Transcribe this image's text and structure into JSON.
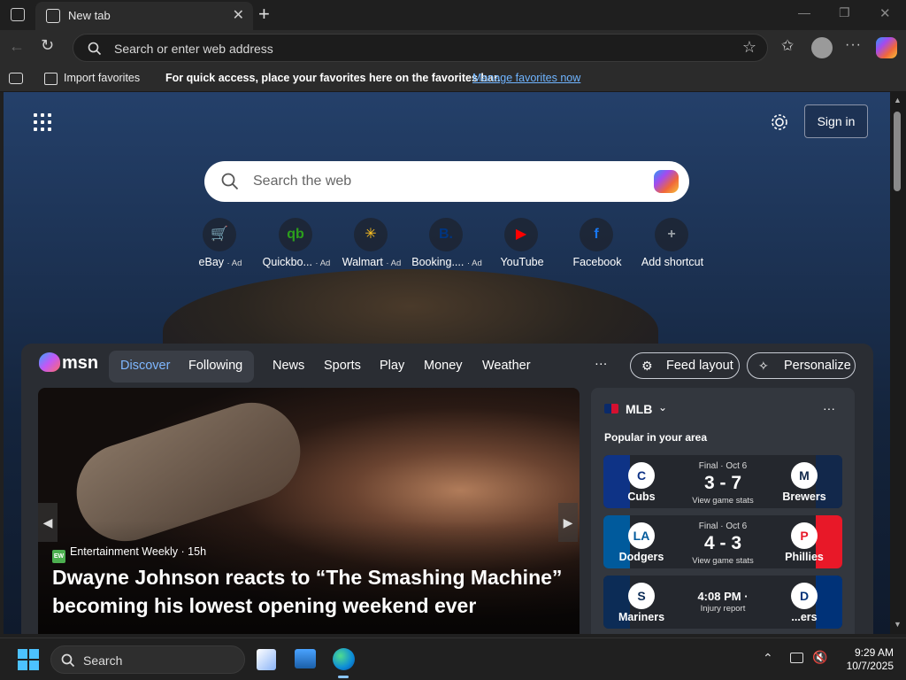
{
  "window": {
    "tab_title": "New tab",
    "tab_close": "✕",
    "new_tab": "+",
    "minimize": "—",
    "restore": "❐",
    "close": "✕"
  },
  "toolbar": {
    "address_placeholder": "Search or enter web address"
  },
  "favorites_bar": {
    "import_label": "Import favorites",
    "hint": "For quick access, place your favorites here on the favorites bar.",
    "manage_link": "Manage favorites now"
  },
  "newtab": {
    "sign_in": "Sign in",
    "search_placeholder": "Search the web",
    "shortcuts": [
      {
        "label": "eBay",
        "ad": "· Ad",
        "glyph": "🛒",
        "color": "#e53238"
      },
      {
        "label": "Quickbo...",
        "ad": "· Ad",
        "glyph": "qb",
        "color": "#2ca01c"
      },
      {
        "label": "Walmart",
        "ad": "· Ad",
        "glyph": "✳",
        "color": "#ffc220"
      },
      {
        "label": "Booking....",
        "ad": "· Ad",
        "glyph": "B.",
        "color": "#003580"
      },
      {
        "label": "YouTube",
        "ad": "",
        "glyph": "▶",
        "color": "#ff0000"
      },
      {
        "label": "Facebook",
        "ad": "",
        "glyph": "f",
        "color": "#1877f2"
      },
      {
        "label": "Add shortcut",
        "ad": "",
        "glyph": "+",
        "color": "#9aa0a6"
      }
    ]
  },
  "feed": {
    "logo": "msn",
    "tabs": [
      "Discover",
      "Following"
    ],
    "nav": [
      "News",
      "Sports",
      "Play",
      "Money",
      "Weather"
    ],
    "more": "···",
    "feed_layout": "Feed layout",
    "personalize": "Personalize",
    "hero": {
      "source_badge": "EW",
      "source": "Entertainment Weekly",
      "age": "· 15h",
      "headline": "Dwayne Johnson reacts to “The Smashing Machine” becoming his lowest opening weekend ever",
      "prev": "◀",
      "next": "▶"
    },
    "sports": {
      "league": "MLB",
      "more": "···",
      "subtitle": "Popular in your area",
      "games": [
        {
          "home": "Cubs",
          "away": "Brewers",
          "status": "Final · Oct 6",
          "score": "3 - 7",
          "sub": "View game stats",
          "home_color": "#0e3386",
          "away_color": "#12284b",
          "home_glyph": "C",
          "away_glyph": "M"
        },
        {
          "home": "Dodgers",
          "away": "Phillies",
          "status": "Final · Oct 6",
          "score": "4 - 3",
          "sub": "View game stats",
          "home_color": "#005a9c",
          "away_color": "#e81828",
          "home_glyph": "LA",
          "away_glyph": "P"
        },
        {
          "home": "Mariners",
          "away": "...ers",
          "status": "",
          "score": "4:08 PM ·",
          "sub": "Injury report",
          "home_color": "#0c2c56",
          "away_color": "#003278",
          "home_glyph": "S",
          "away_glyph": "D"
        }
      ]
    }
  },
  "taskbar": {
    "search": "Search",
    "time": "9:29 AM",
    "date": "10/7/2025"
  }
}
